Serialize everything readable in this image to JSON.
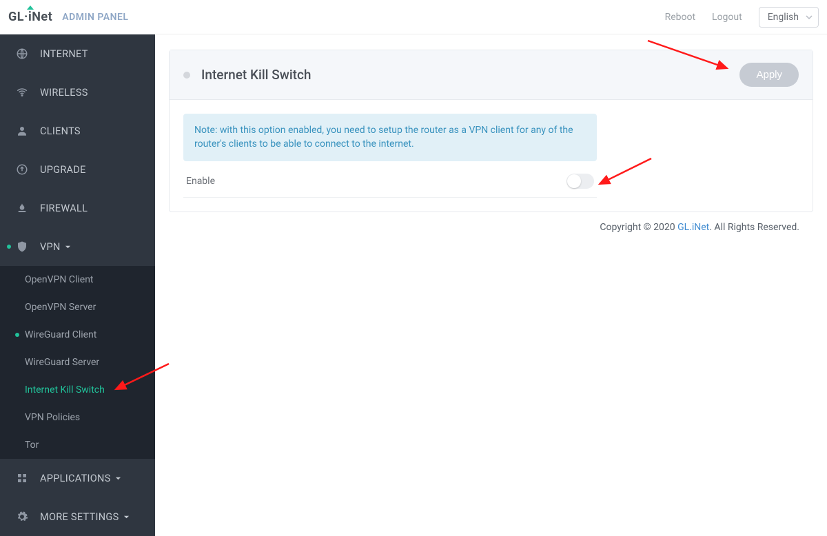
{
  "header": {
    "logo": "GL·iNet",
    "admin_label": "ADMIN PANEL",
    "reboot": "Reboot",
    "logout": "Logout",
    "language": "English"
  },
  "sidebar": {
    "items": [
      {
        "label": "INTERNET"
      },
      {
        "label": "WIRELESS"
      },
      {
        "label": "CLIENTS"
      },
      {
        "label": "UPGRADE"
      },
      {
        "label": "FIREWALL"
      },
      {
        "label": "VPN",
        "expanded": true,
        "status": "on"
      },
      {
        "label": "APPLICATIONS",
        "expanded": false
      },
      {
        "label": "MORE SETTINGS",
        "expanded": false
      }
    ],
    "vpn_sub": [
      {
        "label": "OpenVPN Client"
      },
      {
        "label": "OpenVPN Server"
      },
      {
        "label": "WireGuard Client",
        "status": "on"
      },
      {
        "label": "WireGuard Server"
      },
      {
        "label": "Internet Kill Switch",
        "active": true
      },
      {
        "label": "VPN Policies"
      },
      {
        "label": "Tor"
      }
    ]
  },
  "main": {
    "title": "Internet Kill Switch",
    "apply": "Apply",
    "note": "Note: with this option enabled, you need to setup the router as a VPN client for any of the router's clients to be able to connect to the internet.",
    "enable_label": "Enable",
    "enable_value": false
  },
  "footer": {
    "prefix": "Copyright © 2020 ",
    "link": "GL.iNet",
    "suffix": ". All Rights Reserved."
  }
}
